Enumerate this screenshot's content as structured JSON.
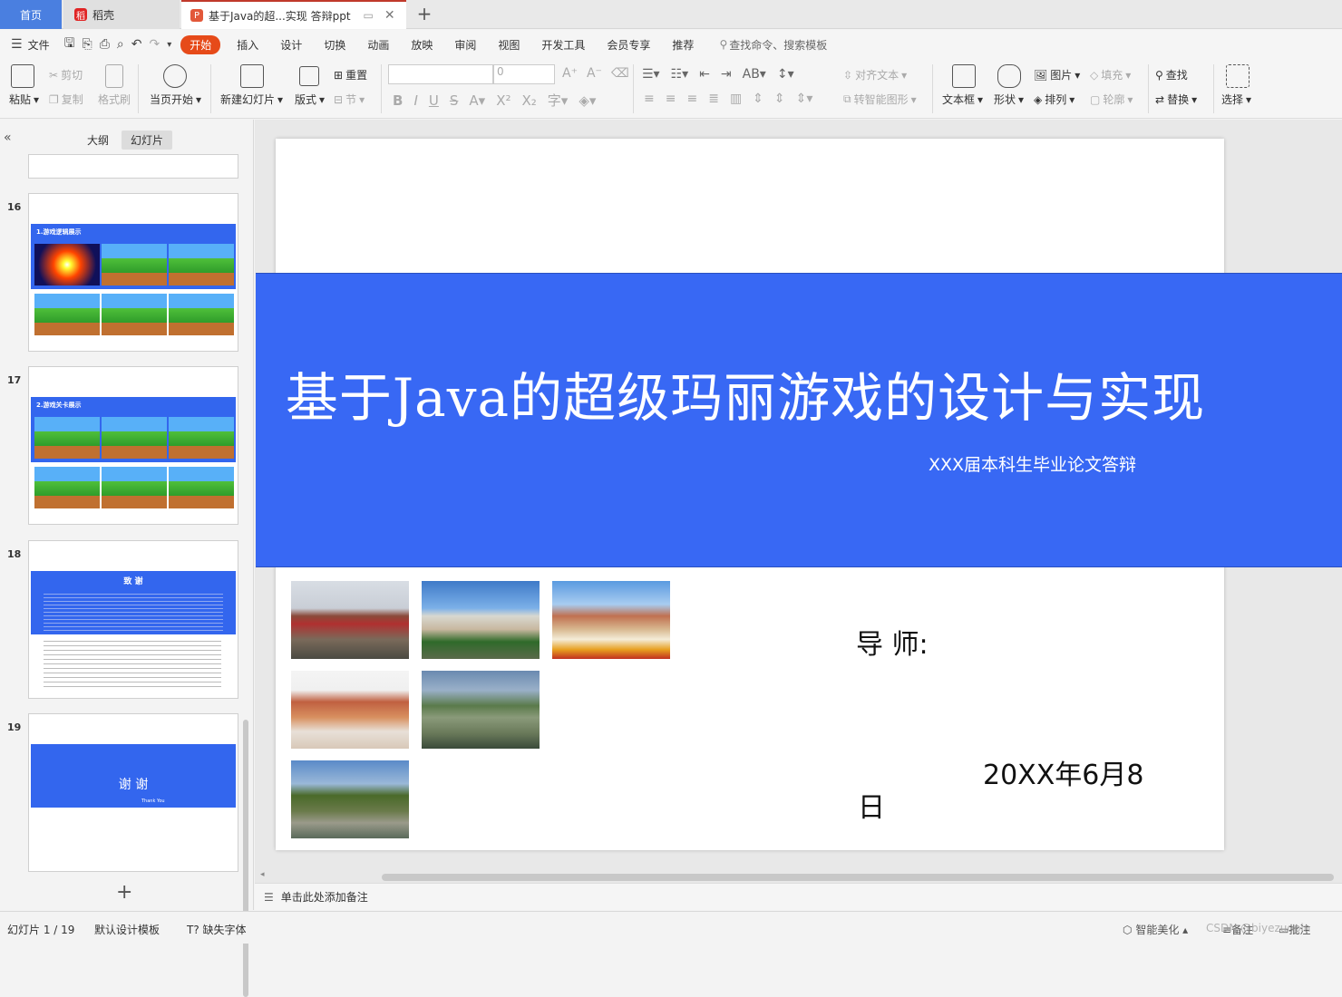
{
  "tabs": {
    "home": "首页",
    "docer": "稻壳",
    "document": "基于Java的超...实现  答辩ppt"
  },
  "menu": {
    "file": "文件",
    "items": [
      "开始",
      "插入",
      "设计",
      "切换",
      "动画",
      "放映",
      "审阅",
      "视图",
      "开发工具",
      "会员专享",
      "推荐"
    ],
    "search_placeholder": "查找命令、搜索模板"
  },
  "toolbar": {
    "paste": "粘贴",
    "cut": "剪切",
    "copy": "复制",
    "format_painter": "格式刷",
    "play_from_current": "当页开始",
    "new_slide": "新建幻灯片",
    "layout": "版式",
    "reset": "重置",
    "section": "节",
    "font_size": "0",
    "align_text": "对齐文本",
    "smartart": "转智能图形",
    "textbox": "文本框",
    "shape": "形状",
    "picture": "图片",
    "arrange": "排列",
    "fill": "填充",
    "outline": "轮廓",
    "find": "查找",
    "replace": "替换",
    "select": "选择"
  },
  "left_panel": {
    "tab_outline": "大纲",
    "tab_slides": "幻灯片",
    "thumbnails": [
      {
        "num": "16",
        "title": "1.游戏逻辑展示"
      },
      {
        "num": "17",
        "title": "2.游戏关卡展示"
      },
      {
        "num": "18",
        "title": "致  谢"
      },
      {
        "num": "19",
        "title": "谢  谢",
        "subtitle": "Thank  You"
      }
    ],
    "add_slide": "+"
  },
  "slide": {
    "title": "基于Java的超级玛丽游戏的设计与实现",
    "subtitle": "XXX届本科生毕业论文答辩",
    "advisor": "导    师:",
    "date_line1": "20XX年6月8",
    "date_line2": "日"
  },
  "notes_placeholder": "单击此处添加备注",
  "status": {
    "slide_counter": "幻灯片 1 / 19",
    "template": "默认设计模板",
    "missing_font": "缺失字体",
    "smart_beautify": "智能美化",
    "notes": "备注",
    "comment": "批注",
    "watermark": "CSDN @biyezuopin"
  }
}
